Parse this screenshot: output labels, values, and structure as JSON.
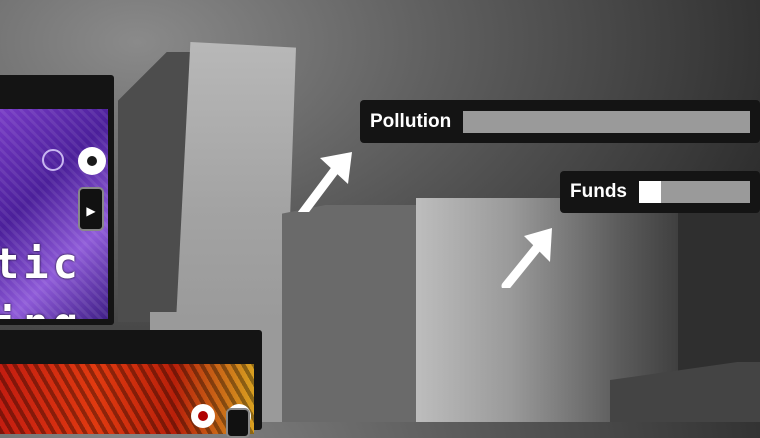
{
  "hud": {
    "pollution": {
      "label": "Pollution",
      "level": 0.0
    },
    "funds": {
      "label": "Funds",
      "level": 0.2
    }
  },
  "cards": [
    {
      "word_lines": [
        "tic",
        "ing"
      ],
      "theme": "purple",
      "icons": [
        "ring-icon",
        "target-icon",
        "play-icon"
      ]
    },
    {
      "theme": "red",
      "icons": [
        "target-icon",
        "target-icon"
      ]
    }
  ],
  "colors": {
    "hud_background": "#141414",
    "bar_track": "#9a9a9a",
    "bar_fill": "#ffffff"
  },
  "icons": {
    "arrow": "arrow-up-right-icon"
  }
}
